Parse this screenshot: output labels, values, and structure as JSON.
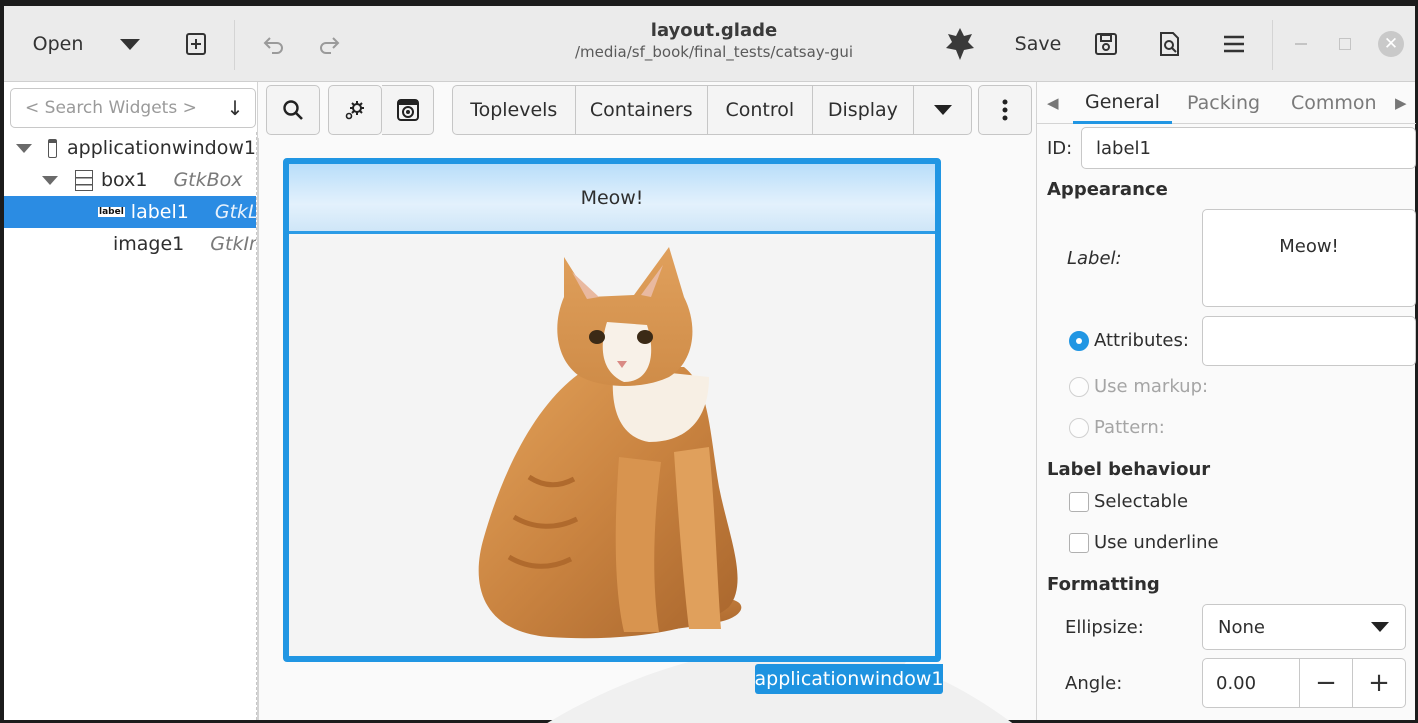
{
  "header": {
    "open_label": "Open",
    "title": "layout.glade",
    "path": "/media/sf_book/final_tests/catsay-gui",
    "save_label": "Save"
  },
  "left_panel": {
    "search_placeholder": "< Search Widgets >",
    "tree": [
      {
        "label": "applicationwindow1",
        "type": ""
      },
      {
        "label": "box1",
        "type": "GtkBox"
      },
      {
        "label": "label1",
        "type": "GtkLabel",
        "icon_text": "label"
      },
      {
        "label": "image1",
        "type": "GtkImage"
      }
    ]
  },
  "toolbar": {
    "groups": [
      "Toplevels",
      "Containers",
      "Control",
      "Display"
    ]
  },
  "canvas": {
    "label_text": "Meow!",
    "window_tag": "applicationwindow1"
  },
  "inspector": {
    "tabs": [
      "General",
      "Packing",
      "Common"
    ],
    "id_label": "ID:",
    "id_value": "label1",
    "appearance_heading": "Appearance",
    "label_label": "Label:",
    "label_value": "Meow!",
    "attributes_label": "Attributes:",
    "use_markup_label": "Use markup:",
    "pattern_label": "Pattern:",
    "behaviour_heading": "Label behaviour",
    "selectable_label": "Selectable",
    "use_underline_label": "Use underline",
    "formatting_heading": "Formatting",
    "ellipsize_label": "Ellipsize:",
    "ellipsize_value": "None",
    "angle_label": "Angle:",
    "angle_value": "0.00"
  },
  "colors": {
    "accent": "#2196e3",
    "selection": "#2b8ce3"
  }
}
